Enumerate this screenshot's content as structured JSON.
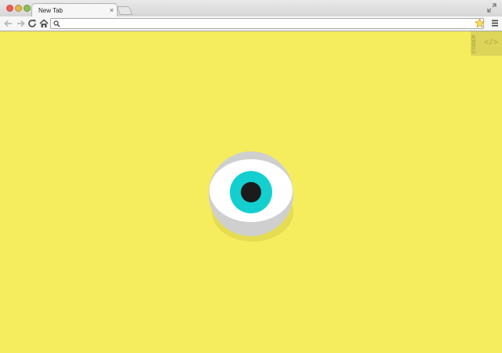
{
  "window": {
    "tab_title": "New Tab",
    "tab_close": "×"
  },
  "toolbar": {
    "omnibox_value": ""
  },
  "extension": {
    "label": "CODER",
    "code_symbol": "</>"
  },
  "colors": {
    "page_background": "#f5ed5d",
    "eye_iris": "#14cfcf",
    "eye_pupil": "#1b1b1b",
    "eye_white": "#ffffff",
    "eye_rim": "#cfcfcf"
  }
}
